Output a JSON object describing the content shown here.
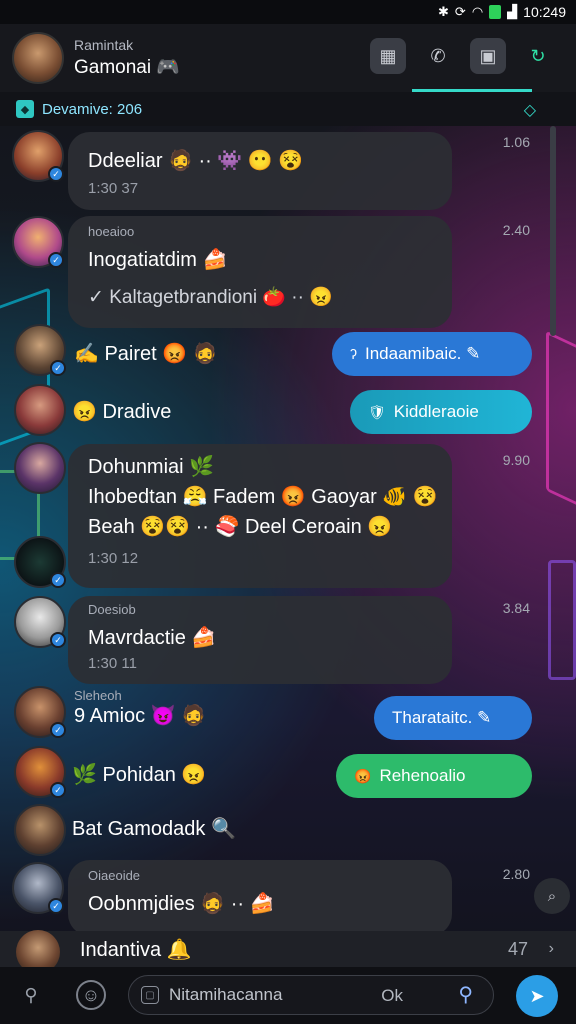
{
  "status": {
    "time": "10:249",
    "icons": [
      "bluetooth-icon",
      "sync-icon",
      "wifi-icon",
      "battery-icon",
      "signal-icon"
    ]
  },
  "header": {
    "subtitle": "Ramintak",
    "title": "Gamonai 🎮"
  },
  "pinned": {
    "text": "Devamive: 206"
  },
  "messages": [
    {
      "type": "bubble",
      "lines": [
        "Ddeeliar 🧔 ·· 👾 😶 😵"
      ],
      "stamp": "1:30 37",
      "time": "1.06"
    },
    {
      "type": "bubble",
      "head": "hoeaioo",
      "lines": [
        "Inogatiatdim 🍰"
      ],
      "sub": "Kaltagetbrandioni 🍅 ·· 😠",
      "time": "2.40"
    },
    {
      "type": "plain",
      "text": "Pairet 😡 🧔",
      "prefix_icon": "✍"
    },
    {
      "type": "plain",
      "text": "😠 Dradive"
    },
    {
      "type": "bubble",
      "lines": [
        "Dohunmiai 🌿",
        "Ihobedtan 😤 Fadem 😡 Gaoyar 🐠 😵",
        "Beah 😵😵 ·· 🍣 Deel Ceroain 😠"
      ],
      "stamp": "1:30 12",
      "time": "9.90"
    },
    {
      "type": "bubble",
      "head": "Doesiob",
      "lines": [
        "Mavrdactie 🍰"
      ],
      "stamp": "1:30 11",
      "time": "3.84"
    },
    {
      "type": "plain",
      "pre": "Sleheoh",
      "text": "Amioc 😈 🧔",
      "prefix_icon": "9"
    },
    {
      "type": "plain",
      "text": "Pohidan 😠",
      "prefix_icon": "🌿"
    },
    {
      "type": "plain",
      "text": "Bat Gamodadk 🔍"
    },
    {
      "type": "bubble",
      "head": "Oiaeoide",
      "lines": [
        "Oobnmjdies 🧔 ·· 🍰"
      ],
      "time": "2.80"
    }
  ],
  "pills": [
    {
      "text": "Indaamibaic. ✎",
      "icon": "ʔ"
    },
    {
      "text": "Kiddleraoie",
      "icon": "🛡"
    },
    {
      "text": "Tharataitc. ✎"
    },
    {
      "text": "Rehenoalio",
      "icon": "😡"
    }
  ],
  "preview": {
    "text": "Indantiva 🔔",
    "time": "47"
  },
  "input": {
    "placeholder": "Nitamihacanna",
    "ok": "Ok"
  },
  "colors": {
    "accent": "#35d9c8",
    "pill_blue": "#2a78d6",
    "pill_green": "#2dbb6b",
    "send": "#2b9ee6"
  }
}
